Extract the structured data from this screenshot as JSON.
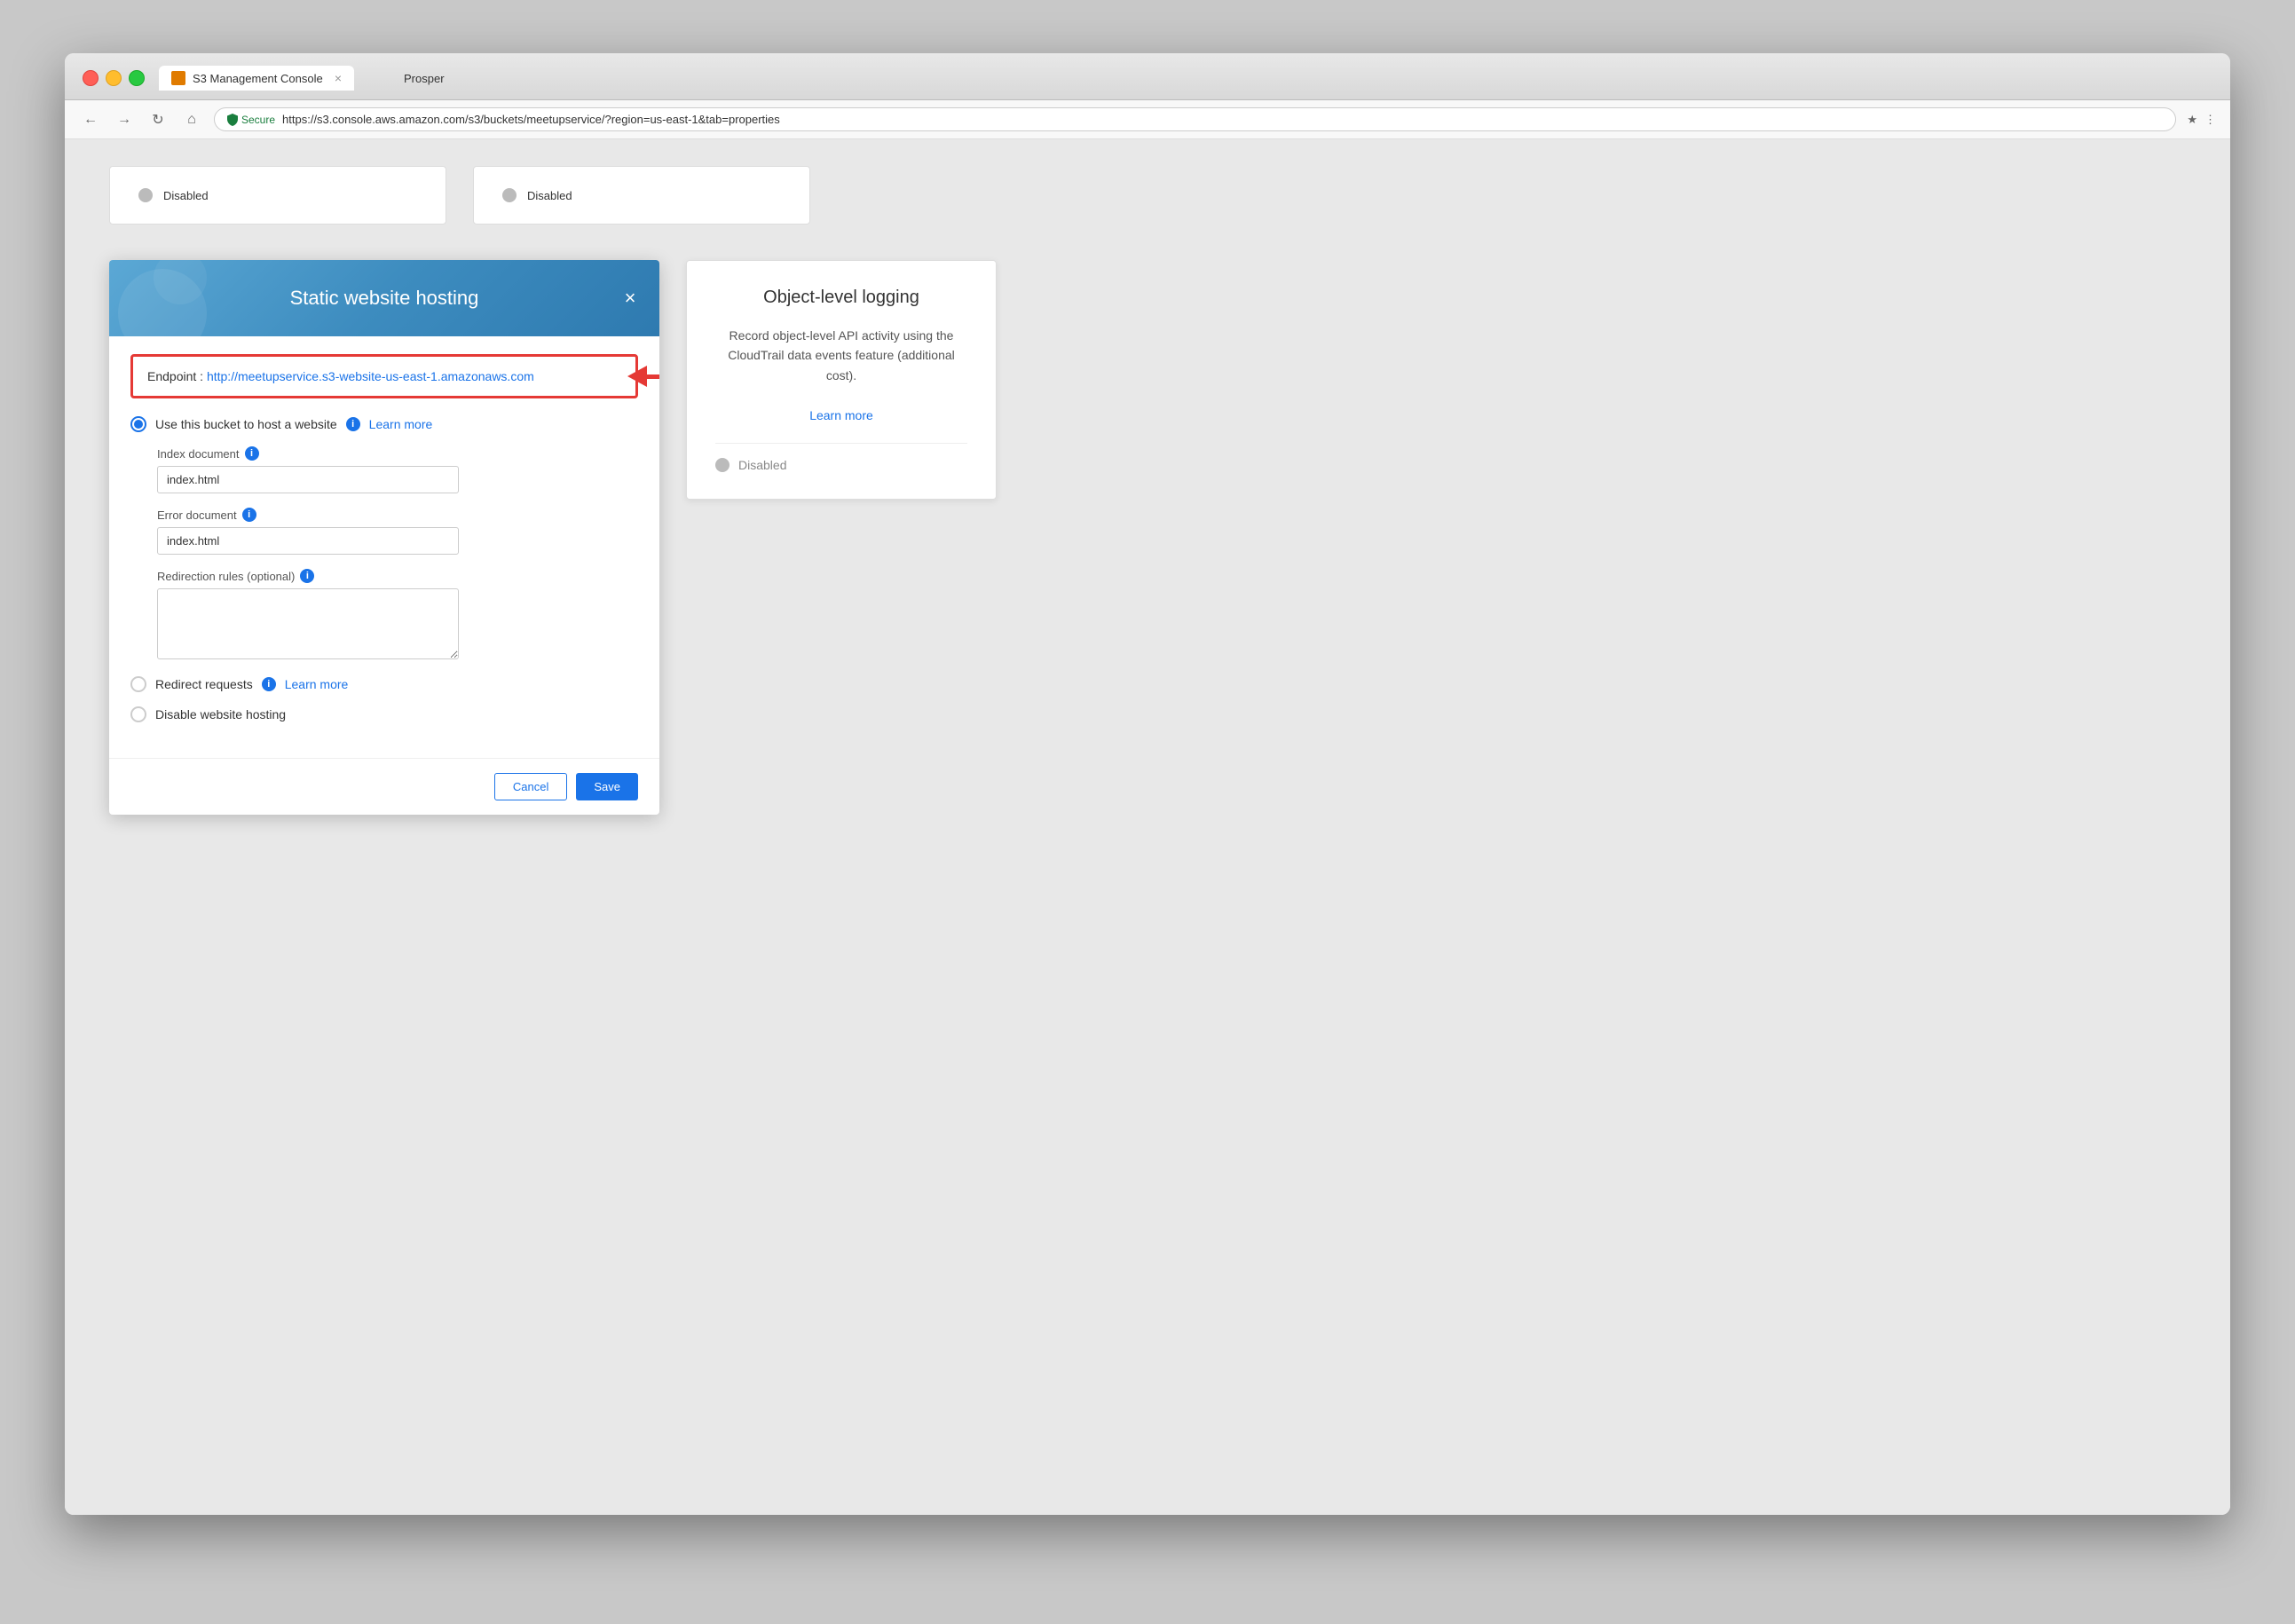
{
  "browser": {
    "tab_title": "S3 Management Console",
    "url_secure": "Secure",
    "url_full": "https://s3.console.aws.amazon.com/s3/buckets/meetupservice/?region=us-east-1&tab=properties",
    "user_name": "Prosper"
  },
  "top_cards": [
    {
      "label": "Disabled"
    },
    {
      "label": "Disabled"
    }
  ],
  "hosting_modal": {
    "title": "Static website hosting",
    "close_label": "×",
    "endpoint_label": "Endpoint :",
    "endpoint_url": "http://meetupservice.s3-website-us-east-1.amazonaws.com",
    "host_option_label": "Use this bucket to host a website",
    "host_learn_more": "Learn more",
    "index_doc_label": "Index document",
    "index_doc_value": "index.html",
    "error_doc_label": "Error document",
    "error_doc_value": "index.html",
    "redirect_rules_label": "Redirection rules (optional)",
    "redirect_rules_value": "",
    "redirect_requests_label": "Redirect requests",
    "redirect_learn_more": "Learn more",
    "disable_hosting_label": "Disable website hosting",
    "cancel_label": "Cancel",
    "save_label": "Save"
  },
  "logging_card": {
    "title": "Object-level logging",
    "description": "Record object-level API activity using the CloudTrail data events feature (additional cost).",
    "learn_more": "Learn more",
    "disabled_label": "Disabled"
  }
}
